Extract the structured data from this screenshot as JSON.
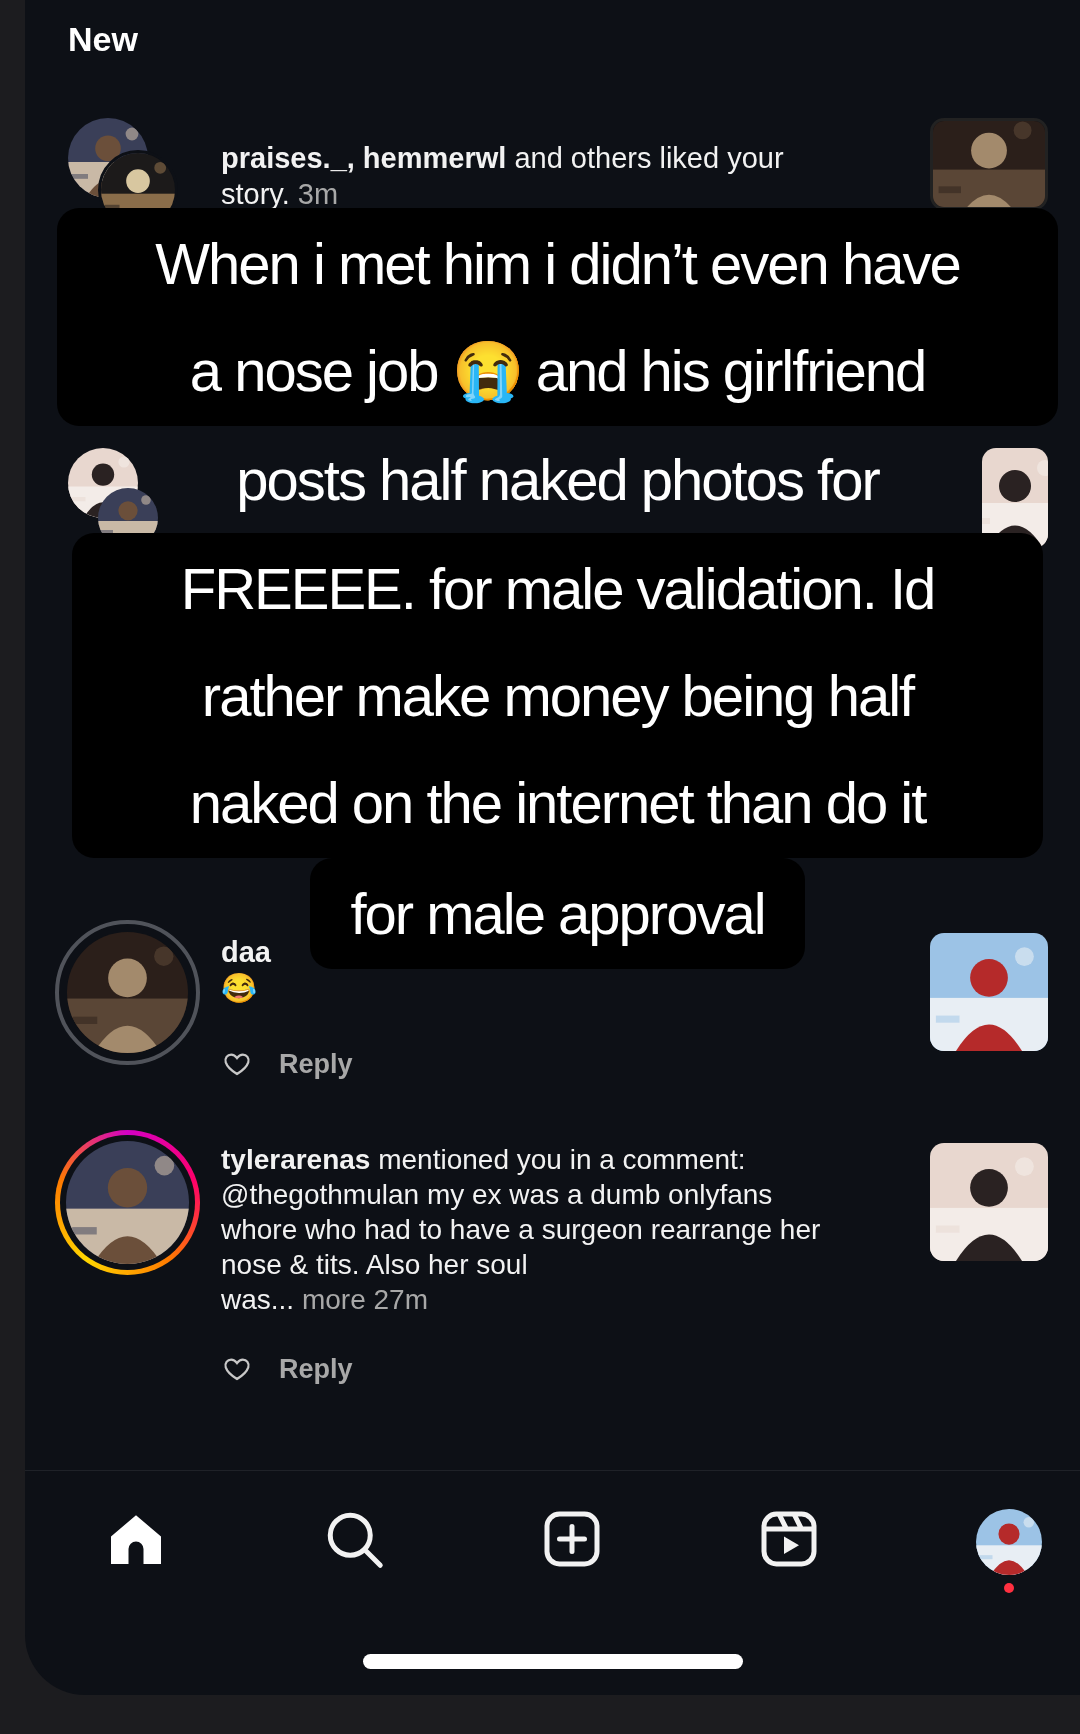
{
  "header": {
    "title": "New"
  },
  "notifications": [
    {
      "kind": "story_like",
      "text": "**praises._, hemmerwl** and others liked your story.",
      "time": "3m"
    },
    {
      "kind": "covered"
    },
    {
      "kind": "comment",
      "user": "daa",
      "text": "😂",
      "reply": "Reply"
    },
    {
      "kind": "mention",
      "text": "**tylerarenas** mentioned you in a comment: @thegothmulan my ex was a dumb onlyfans whore who had to have a surgeon rearrange her nose & tits. Also her soul\nwas...",
      "more": "more",
      "time": "27m",
      "story_ring": true,
      "reply": "Reply"
    }
  ],
  "caption": {
    "blocks": [
      {
        "boxed": true,
        "lines": [
          "When i met him i didn’t even have",
          "a nose job 😭 and his girlfriend"
        ]
      },
      {
        "boxed": false,
        "lines": [
          "posts half naked photos for"
        ]
      },
      {
        "boxed": true,
        "lines": [
          "FREEEE. for male validation. Id",
          "rather make money being half",
          "naked on the internet than do it"
        ]
      },
      {
        "boxed": true,
        "lines": [
          "for male approval"
        ]
      }
    ]
  },
  "nav": [
    {
      "kind": "home",
      "selected": true
    },
    {
      "kind": "search",
      "selected": false
    },
    {
      "kind": "create",
      "selected": false
    },
    {
      "kind": "reels",
      "selected": false
    },
    {
      "kind": "profile",
      "selected": false,
      "badge": true
    }
  ]
}
